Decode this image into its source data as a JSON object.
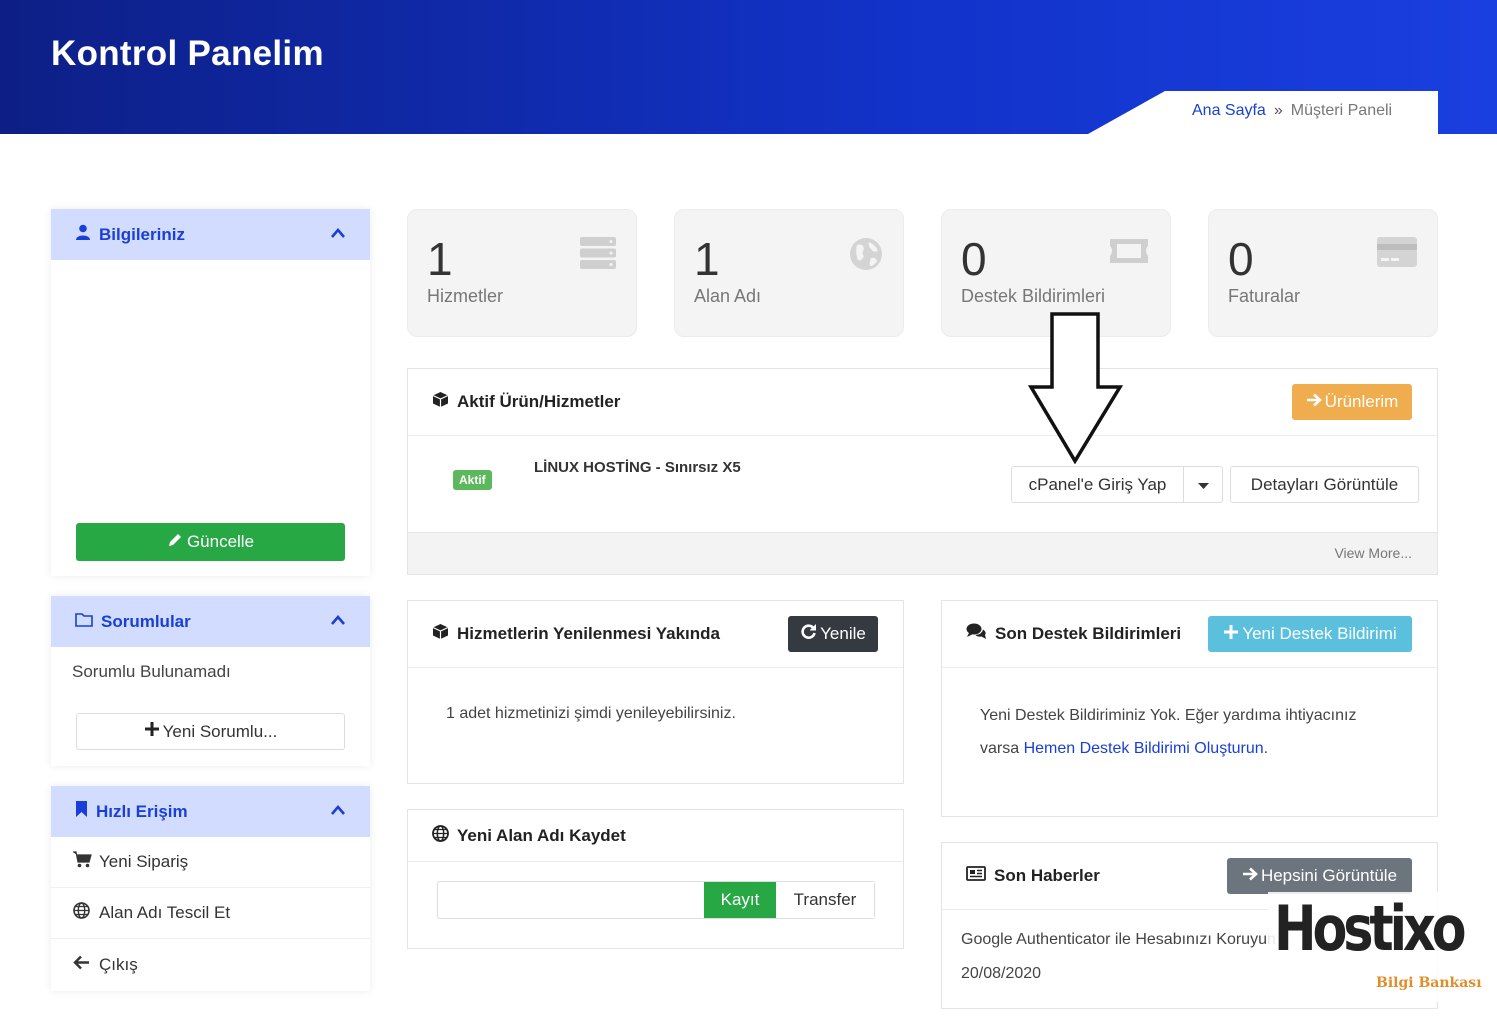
{
  "header": {
    "title": "Kontrol Panelim"
  },
  "breadcrumb": {
    "home": "Ana Sayfa",
    "sep": "»",
    "current": "Müşteri Paneli"
  },
  "sidebar": {
    "info": {
      "title": "Bilgileriniz",
      "update_label": "Güncelle"
    },
    "contacts": {
      "title": "Sorumlular",
      "empty_text": "Sorumlu Bulunamadı",
      "new_label": "Yeni Sorumlu..."
    },
    "quick": {
      "title": "Hızlı Erişim",
      "items": [
        {
          "label": "Yeni Sipariş",
          "icon": "cart-icon"
        },
        {
          "label": "Alan Adı Tescil Et",
          "icon": "globe-icon"
        },
        {
          "label": "Çıkış",
          "icon": "arrow-left-icon"
        }
      ]
    }
  },
  "stats": [
    {
      "value": "1",
      "label": "Hizmetler",
      "icon": "server-icon"
    },
    {
      "value": "1",
      "label": "Alan Adı",
      "icon": "globe-icon"
    },
    {
      "value": "0",
      "label": "Destek Bildirimleri",
      "icon": "ticket-icon"
    },
    {
      "value": "0",
      "label": "Faturalar",
      "icon": "credit-card-icon"
    }
  ],
  "active_services": {
    "title": "Aktif Ürün/Hizmetler",
    "my_products_label": "Ürünlerim",
    "service": {
      "badge": "Aktif",
      "name": "LİNUX HOSTİNG - Sınırsız X5"
    },
    "cpanel_label": "cPanel'e Giriş Yap",
    "details_label": "Detayları Görüntüle",
    "view_more": "View More..."
  },
  "renewals": {
    "title": "Hizmetlerin Yenilenmesi Yakında",
    "renew_label": "Yenile",
    "text": "1 adet hizmetinizi şimdi yenileyebilirsiniz."
  },
  "tickets": {
    "title": "Son Destek Bildirimleri",
    "new_label": "Yeni Destek Bildirimi",
    "text_before": "Yeni Destek Bildiriminiz Yok. Eğer yardıma ihtiyacınız varsa",
    "link_text": "Hemen Destek Bildirimi Oluşturun",
    "text_after": "."
  },
  "domain": {
    "title": "Yeni Alan Adı Kaydet",
    "register_label": "Kayıt",
    "transfer_label": "Transfer",
    "input_value": ""
  },
  "news": {
    "title": "Son Haberler",
    "view_all_label": "Hepsini Görüntüle",
    "item_title": "Google Authenticator ile Hesabınızı Koruyun",
    "item_date": "20/08/2020"
  },
  "watermark": {
    "brand": "Hostixo",
    "tagline": "Bilgi Bankası"
  },
  "colors": {
    "header": "#1233c9",
    "accent": "#1a3fd8",
    "green": "#28a745",
    "orange": "#f0ad4e",
    "info": "#5bc0de",
    "dark": "#343a40",
    "grey": "#6c757d"
  }
}
